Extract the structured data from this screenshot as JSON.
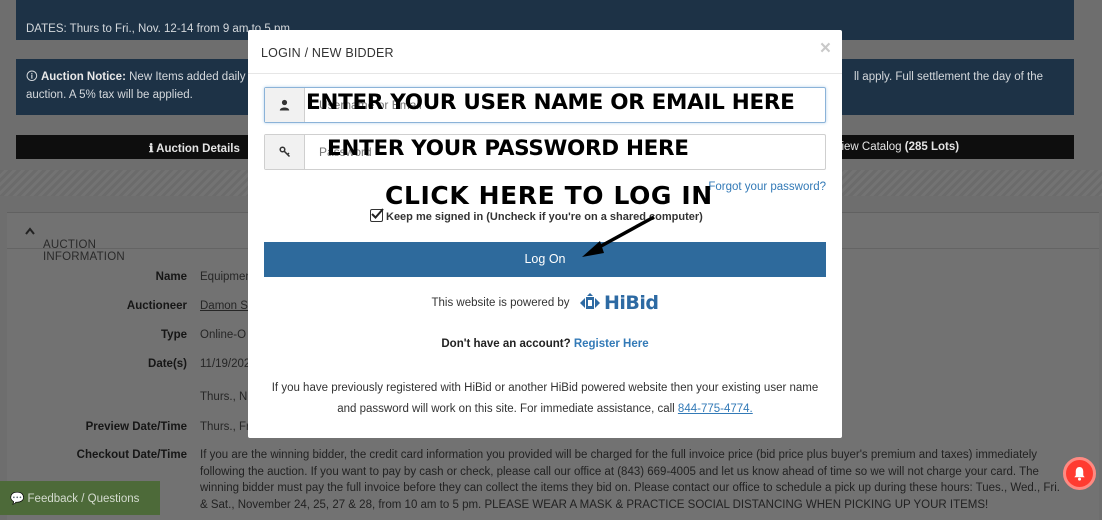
{
  "background": {
    "notice1": {
      "text": "DATES: Thurs to Fri., Nov. 12-14 from 9 am to 5 pm."
    },
    "notice2": {
      "label": "Auction Notice:",
      "text_left": "New Items added daily",
      "text_right": "ll apply. Full settlement the day of the",
      "line2": "auction. A 5% tax will be applied."
    },
    "tabs": {
      "details": "Auction Details",
      "catalog_prefix": "View Catalog ",
      "catalog_count": "(285 Lots)"
    },
    "panel_title": "AUCTION INFORMATION",
    "rows": [
      {
        "label": "Name",
        "value": "Equipmen"
      },
      {
        "label": "Auctioneer",
        "value": "Damon S"
      },
      {
        "label": "Type",
        "value": "Online-O"
      },
      {
        "label": "Date(s)",
        "value": "11/19/202"
      },
      {
        "label": "",
        "value": "Thurs., N"
      },
      {
        "label": "Preview Date/Time",
        "value": "Thurs., Fr"
      },
      {
        "label": "Checkout Date/Time",
        "value": ""
      }
    ],
    "checkout_text": "If you are the winning bidder, the credit card information you provided will be charged for the full invoice price (bid price plus buyer's premium and taxes) immediately following the auction. If you want to pay by cash or check, please call our office at (843) 669-4005 and let us know ahead of time so we will not charge your card. The winning bidder must pay the full invoice before they can collect the items they bid on. Please contact our office to schedule a pick up during these hours: Tues., Wed., Fri. & Sat., November 24, 25, 27 & 28, from 10 am to 5 pm. PLEASE WEAR A MASK & PRACTICE SOCIAL DISTANCING WHEN PICKING UP YOUR ITEMS!",
    "feedback": "Feedback / Questions"
  },
  "modal": {
    "title": "LOGIN / NEW BIDDER",
    "close": "×",
    "username_placeholder": "Username or Email",
    "password_placeholder": "Password",
    "overlay_user": "ENTER YOUR USER NAME OR EMAIL HERE",
    "overlay_pass": "ENTER YOUR PASSWORD HERE",
    "overlay_click": "CLICK HERE TO LOG IN",
    "forgot": "Forgot your password?",
    "keep_signed_in": "Keep me signed in (Uncheck if you're on a shared computer)",
    "keep_checked": true,
    "login_button": "Log On",
    "powered_by": "This website is powered by",
    "brand": "HiBid",
    "no_account": "Don't have an account?",
    "register": "Register Here",
    "reg_info": "If you have previously registered with HiBid or another HiBid powered website then your existing user name and password will work on this site. For immediate assistance, call",
    "phone": "844-775-4774."
  },
  "colors": {
    "primary": "#2e6a9c",
    "link": "#337ab7",
    "notice_bg": "#1d3246",
    "alert": "#ff3b30",
    "feedback_bg": "#4d6a39"
  }
}
